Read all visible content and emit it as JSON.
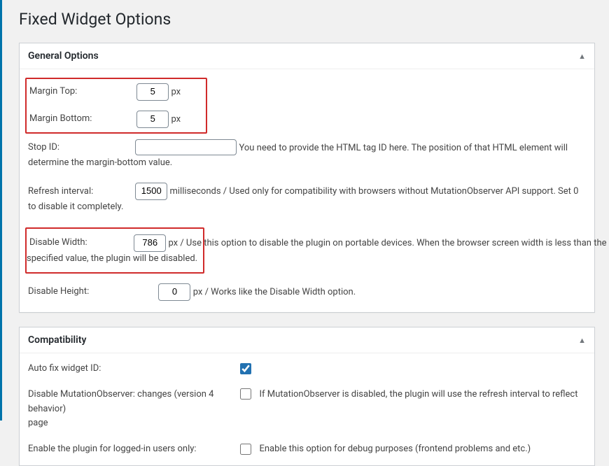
{
  "page_title": "Fixed Widget Options",
  "general": {
    "heading": "General Options",
    "margin_top": {
      "label": "Margin Top:",
      "value": "5",
      "unit": "px"
    },
    "margin_bottom": {
      "label": "Margin Bottom:",
      "value": "5",
      "unit": "px"
    },
    "stop_id": {
      "label": "Stop ID:",
      "value": "",
      "desc": "You need to provide the HTML tag ID here. The position of that HTML element will determine the margin-bottom value."
    },
    "refresh": {
      "label": "Refresh interval:",
      "value": "1500",
      "desc": "milliseconds / Used only for compatibility with browsers without MutationObserver API support. Set 0 to disable it completely."
    },
    "disable_width": {
      "label": "Disable Width:",
      "value": "786",
      "desc": "px / Use this option to disable the plugin on portable devices. When the browser screen width is less than the specified value, the plugin will be disabled."
    },
    "disable_height": {
      "label": "Disable Height:",
      "value": "0",
      "desc": "px / Works like the Disable Width option."
    }
  },
  "compat": {
    "heading": "Compatibility",
    "autofix": {
      "label": "Auto fix widget ID:",
      "checked": true
    },
    "disable_mo": {
      "label": "Disable MutationObserver: changes (version 4 behavior)",
      "desc": "If MutationObserver is disabled, the plugin will use the refresh interval to reflect page"
    },
    "logged_in": {
      "label": "Enable the plugin for logged-in users only:",
      "desc": "Enable this option for debug purposes (frontend problems and etc.)"
    }
  }
}
